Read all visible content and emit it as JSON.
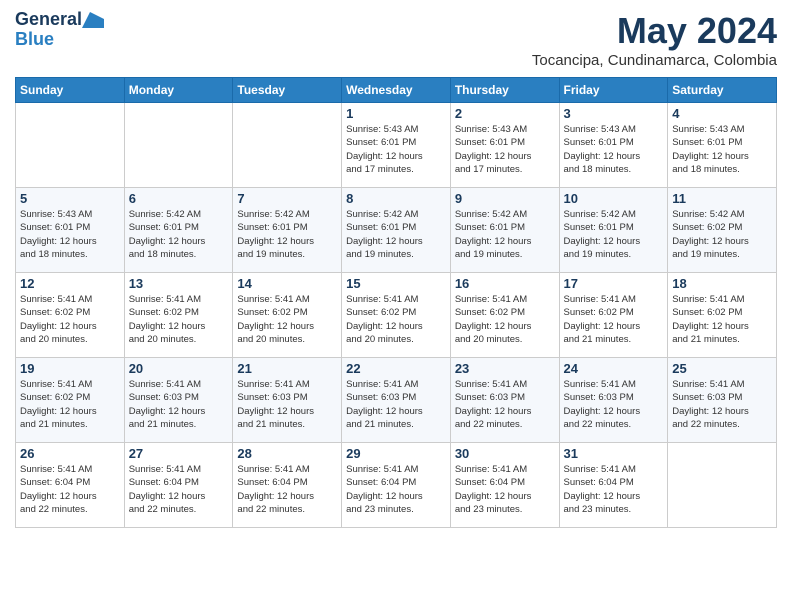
{
  "header": {
    "logo_line1": "General",
    "logo_line2": "Blue",
    "month": "May 2024",
    "location": "Tocancipa, Cundinamarca, Colombia"
  },
  "weekdays": [
    "Sunday",
    "Monday",
    "Tuesday",
    "Wednesday",
    "Thursday",
    "Friday",
    "Saturday"
  ],
  "weeks": [
    [
      {
        "day": "",
        "info": ""
      },
      {
        "day": "",
        "info": ""
      },
      {
        "day": "",
        "info": ""
      },
      {
        "day": "1",
        "info": "Sunrise: 5:43 AM\nSunset: 6:01 PM\nDaylight: 12 hours\nand 17 minutes."
      },
      {
        "day": "2",
        "info": "Sunrise: 5:43 AM\nSunset: 6:01 PM\nDaylight: 12 hours\nand 17 minutes."
      },
      {
        "day": "3",
        "info": "Sunrise: 5:43 AM\nSunset: 6:01 PM\nDaylight: 12 hours\nand 18 minutes."
      },
      {
        "day": "4",
        "info": "Sunrise: 5:43 AM\nSunset: 6:01 PM\nDaylight: 12 hours\nand 18 minutes."
      }
    ],
    [
      {
        "day": "5",
        "info": "Sunrise: 5:43 AM\nSunset: 6:01 PM\nDaylight: 12 hours\nand 18 minutes."
      },
      {
        "day": "6",
        "info": "Sunrise: 5:42 AM\nSunset: 6:01 PM\nDaylight: 12 hours\nand 18 minutes."
      },
      {
        "day": "7",
        "info": "Sunrise: 5:42 AM\nSunset: 6:01 PM\nDaylight: 12 hours\nand 19 minutes."
      },
      {
        "day": "8",
        "info": "Sunrise: 5:42 AM\nSunset: 6:01 PM\nDaylight: 12 hours\nand 19 minutes."
      },
      {
        "day": "9",
        "info": "Sunrise: 5:42 AM\nSunset: 6:01 PM\nDaylight: 12 hours\nand 19 minutes."
      },
      {
        "day": "10",
        "info": "Sunrise: 5:42 AM\nSunset: 6:01 PM\nDaylight: 12 hours\nand 19 minutes."
      },
      {
        "day": "11",
        "info": "Sunrise: 5:42 AM\nSunset: 6:02 PM\nDaylight: 12 hours\nand 19 minutes."
      }
    ],
    [
      {
        "day": "12",
        "info": "Sunrise: 5:41 AM\nSunset: 6:02 PM\nDaylight: 12 hours\nand 20 minutes."
      },
      {
        "day": "13",
        "info": "Sunrise: 5:41 AM\nSunset: 6:02 PM\nDaylight: 12 hours\nand 20 minutes."
      },
      {
        "day": "14",
        "info": "Sunrise: 5:41 AM\nSunset: 6:02 PM\nDaylight: 12 hours\nand 20 minutes."
      },
      {
        "day": "15",
        "info": "Sunrise: 5:41 AM\nSunset: 6:02 PM\nDaylight: 12 hours\nand 20 minutes."
      },
      {
        "day": "16",
        "info": "Sunrise: 5:41 AM\nSunset: 6:02 PM\nDaylight: 12 hours\nand 20 minutes."
      },
      {
        "day": "17",
        "info": "Sunrise: 5:41 AM\nSunset: 6:02 PM\nDaylight: 12 hours\nand 21 minutes."
      },
      {
        "day": "18",
        "info": "Sunrise: 5:41 AM\nSunset: 6:02 PM\nDaylight: 12 hours\nand 21 minutes."
      }
    ],
    [
      {
        "day": "19",
        "info": "Sunrise: 5:41 AM\nSunset: 6:02 PM\nDaylight: 12 hours\nand 21 minutes."
      },
      {
        "day": "20",
        "info": "Sunrise: 5:41 AM\nSunset: 6:03 PM\nDaylight: 12 hours\nand 21 minutes."
      },
      {
        "day": "21",
        "info": "Sunrise: 5:41 AM\nSunset: 6:03 PM\nDaylight: 12 hours\nand 21 minutes."
      },
      {
        "day": "22",
        "info": "Sunrise: 5:41 AM\nSunset: 6:03 PM\nDaylight: 12 hours\nand 21 minutes."
      },
      {
        "day": "23",
        "info": "Sunrise: 5:41 AM\nSunset: 6:03 PM\nDaylight: 12 hours\nand 22 minutes."
      },
      {
        "day": "24",
        "info": "Sunrise: 5:41 AM\nSunset: 6:03 PM\nDaylight: 12 hours\nand 22 minutes."
      },
      {
        "day": "25",
        "info": "Sunrise: 5:41 AM\nSunset: 6:03 PM\nDaylight: 12 hours\nand 22 minutes."
      }
    ],
    [
      {
        "day": "26",
        "info": "Sunrise: 5:41 AM\nSunset: 6:04 PM\nDaylight: 12 hours\nand 22 minutes."
      },
      {
        "day": "27",
        "info": "Sunrise: 5:41 AM\nSunset: 6:04 PM\nDaylight: 12 hours\nand 22 minutes."
      },
      {
        "day": "28",
        "info": "Sunrise: 5:41 AM\nSunset: 6:04 PM\nDaylight: 12 hours\nand 22 minutes."
      },
      {
        "day": "29",
        "info": "Sunrise: 5:41 AM\nSunset: 6:04 PM\nDaylight: 12 hours\nand 23 minutes."
      },
      {
        "day": "30",
        "info": "Sunrise: 5:41 AM\nSunset: 6:04 PM\nDaylight: 12 hours\nand 23 minutes."
      },
      {
        "day": "31",
        "info": "Sunrise: 5:41 AM\nSunset: 6:04 PM\nDaylight: 12 hours\nand 23 minutes."
      },
      {
        "day": "",
        "info": ""
      }
    ]
  ]
}
